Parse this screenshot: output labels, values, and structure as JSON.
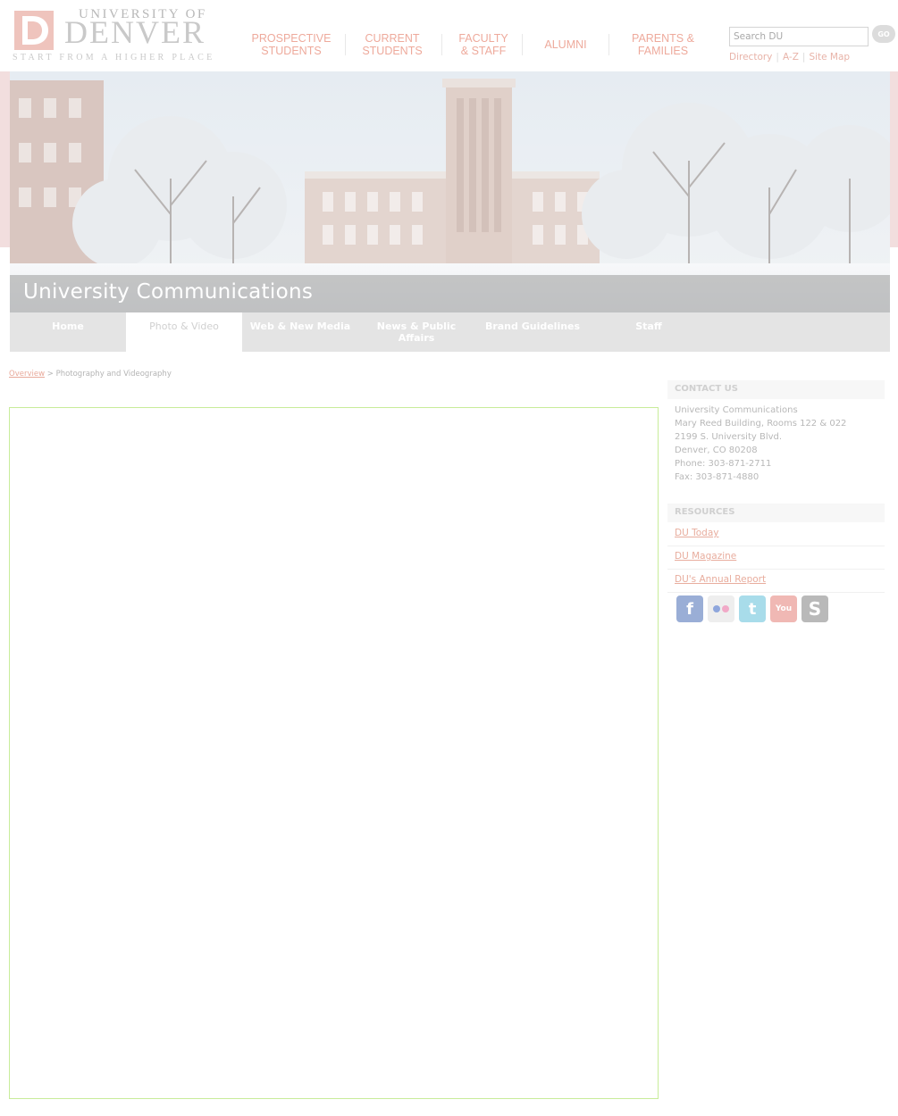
{
  "header": {
    "logo": {
      "line1": "UNIVERSITY OF",
      "line2": "DENVER",
      "tagline": "START FROM A HIGHER PLACE"
    },
    "nav": [
      {
        "label": "PROSPECTIVE\nSTUDENTS",
        "key": "prospective-students"
      },
      {
        "label": "CURRENT\nSTUDENTS",
        "key": "current-students"
      },
      {
        "label": "FACULTY\n& STAFF",
        "key": "faculty-staff"
      },
      {
        "label": "ALUMNI",
        "key": "alumni"
      },
      {
        "label": "PARENTS &\nFAMILIES",
        "key": "parents-families"
      }
    ],
    "search": {
      "value": "Search DU",
      "button_label": "GO"
    },
    "util_links": {
      "directory": "Directory",
      "az": "A-Z",
      "sitemap": "Site Map",
      "separator": "|"
    }
  },
  "banner": {
    "title": "University Communications"
  },
  "subnav": {
    "items": [
      {
        "label": "Home",
        "active": false
      },
      {
        "label": "Photo & Video",
        "active": true
      },
      {
        "label": "Web & New Media",
        "active": false
      },
      {
        "label": "News & Public Affairs",
        "active": false
      },
      {
        "label": "Brand Guidelines",
        "active": false
      },
      {
        "label": "Staff",
        "active": false
      }
    ]
  },
  "breadcrumb": {
    "link": "Overview",
    "separator": " > ",
    "current": "Photography and Videography"
  },
  "sidebar": {
    "contact": {
      "heading": "CONTACT US",
      "lines": [
        "University Communications",
        "Mary Reed Building, Rooms 122 & 022",
        "2199 S. University Blvd.",
        "Denver, CO 80208",
        "Phone: 303-871-2711",
        "Fax: 303-871-4880"
      ]
    },
    "resources": {
      "heading": "RESOURCES",
      "items": [
        "DU Today",
        "DU Magazine",
        "DU's Annual Report"
      ]
    },
    "social": [
      {
        "icon": "facebook-icon",
        "glyph": "f",
        "color": "#9aaed6"
      },
      {
        "icon": "flickr-icon",
        "glyph": "••",
        "color": "#eeeeee"
      },
      {
        "icon": "twitter-icon",
        "glyph": "t",
        "color": "#a8dcea"
      },
      {
        "icon": "youtube-icon",
        "glyph": "You",
        "color": "#f0b8b4"
      },
      {
        "icon": "smugmug-icon",
        "glyph": "S",
        "color": "#b9b9b9"
      }
    ]
  },
  "colors": {
    "accent_nav": "#eeaa9c",
    "link": "#e8ad9e",
    "frame_border": "#c8ec9a",
    "subnav_bg": "#e4e4e4"
  }
}
